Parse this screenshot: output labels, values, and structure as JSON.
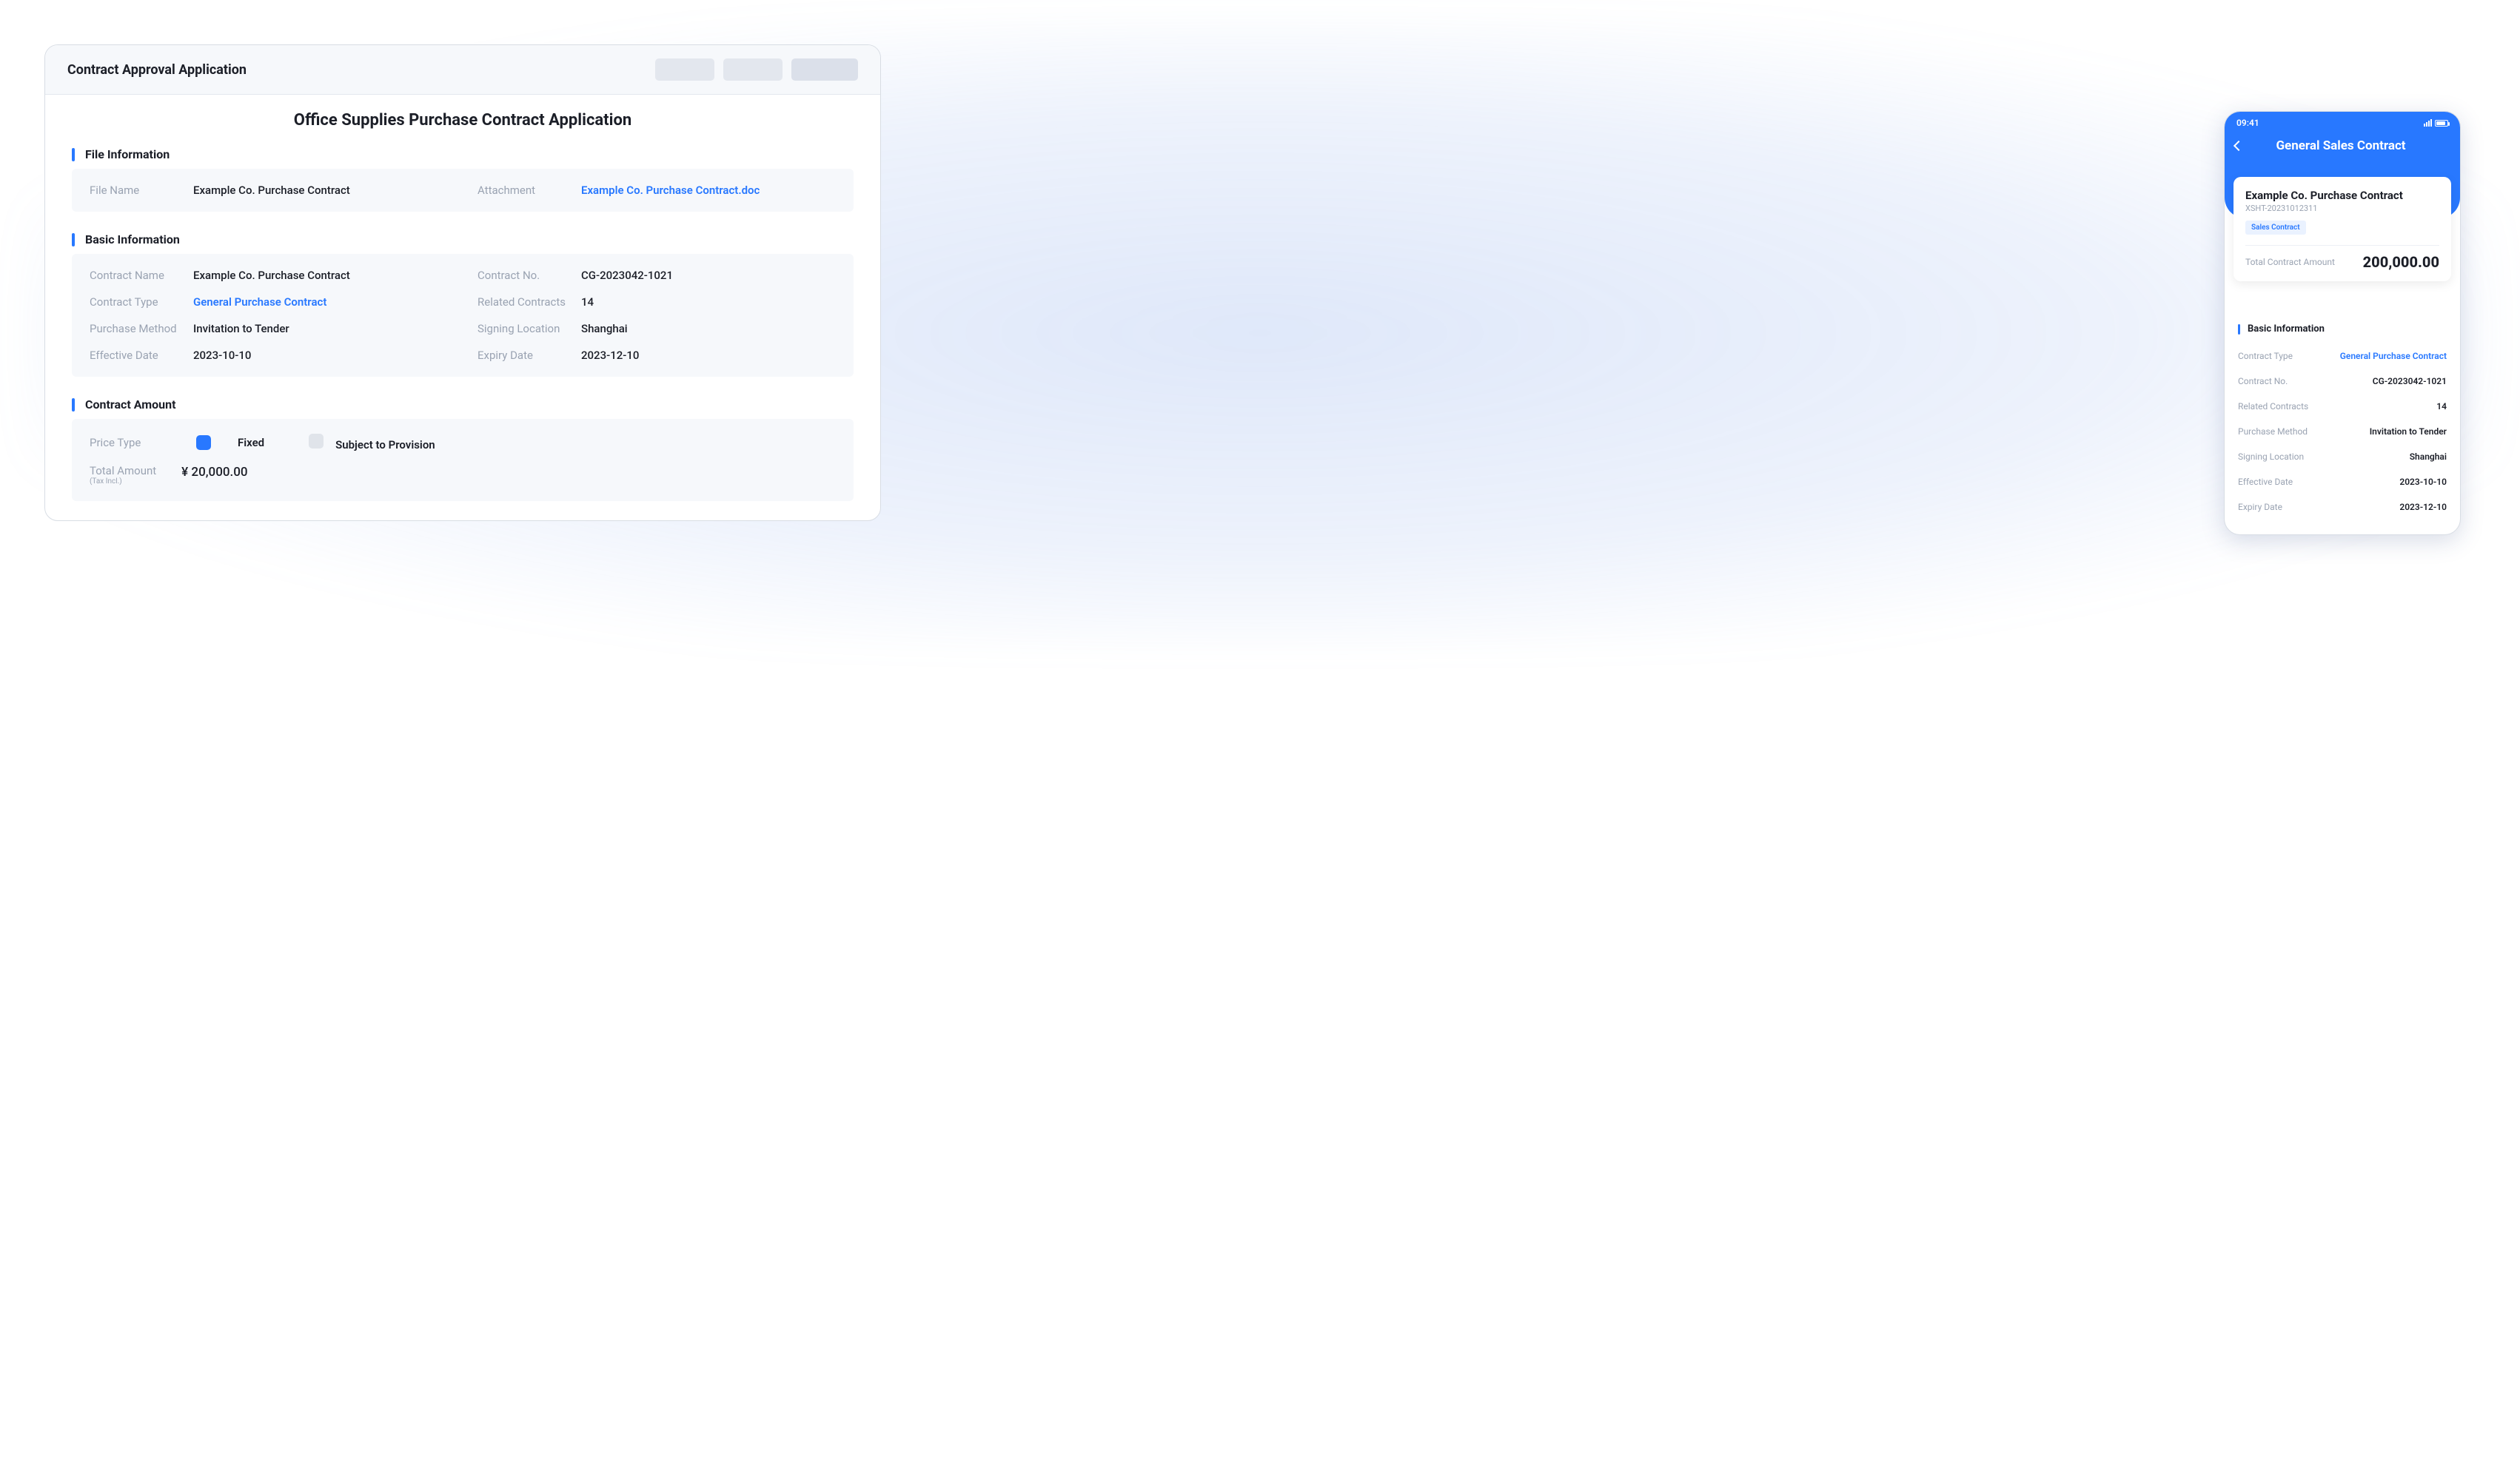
{
  "desktop": {
    "header_title": "Contract Approval Application",
    "contract_title": "Office Supplies Purchase Contract Application",
    "file_info": {
      "section_title": "File Information",
      "file_name_label": "File Name",
      "file_name_value": "Example Co. Purchase Contract",
      "attachment_label": "Attachment",
      "attachment_value": "Example Co. Purchase Contract.doc"
    },
    "basic_info": {
      "section_title": "Basic Information",
      "contract_name_label": "Contract Name",
      "contract_name_value": "Example Co. Purchase Contract",
      "contract_no_label": "Contract No.",
      "contract_no_value": "CG-2023042-1021",
      "contract_type_label": "Contract Type",
      "contract_type_value": "General Purchase Contract",
      "related_contracts_label": "Related Contracts",
      "related_contracts_value": "14",
      "purchase_method_label": "Purchase Method",
      "purchase_method_value": "Invitation to Tender",
      "signing_location_label": "Signing Location",
      "signing_location_value": "Shanghai",
      "effective_date_label": "Effective Date",
      "effective_date_value": "2023-10-10",
      "expiry_date_label": "Expiry Date",
      "expiry_date_value": "2023-12-10"
    },
    "amount": {
      "section_title": "Contract Amount",
      "price_type_label": "Price Type",
      "option_fixed": "Fixed",
      "option_provision": "Subject to Provision",
      "total_label_main": "Total Amount",
      "total_label_sub": "(Tax Incl.)",
      "total_value": "¥ 20,000.00"
    }
  },
  "mobile": {
    "status_time": "09:41",
    "page_title": "General Sales Contract",
    "summary": {
      "title": "Example Co. Purchase Contract",
      "code": "XSHT-20231012311",
      "tag": "Sales Contract",
      "total_label": "Total Contract Amount",
      "total_value": "200,000.00"
    },
    "basic": {
      "section_title": "Basic Information",
      "contract_type_label": "Contract Type",
      "contract_type_value": "General Purchase Contract",
      "contract_no_label": "Contract No.",
      "contract_no_value": "CG-2023042-1021",
      "related_contracts_label": "Related Contracts",
      "related_contracts_value": "14",
      "purchase_method_label": "Purchase Method",
      "purchase_method_value": "Invitation to Tender",
      "signing_location_label": "Signing Location",
      "signing_location_value": "Shanghai",
      "effective_date_label": "Effective Date",
      "effective_date_value": "2023-10-10",
      "expiry_date_label": "Expiry Date",
      "expiry_date_value": "2023-12-10"
    }
  }
}
